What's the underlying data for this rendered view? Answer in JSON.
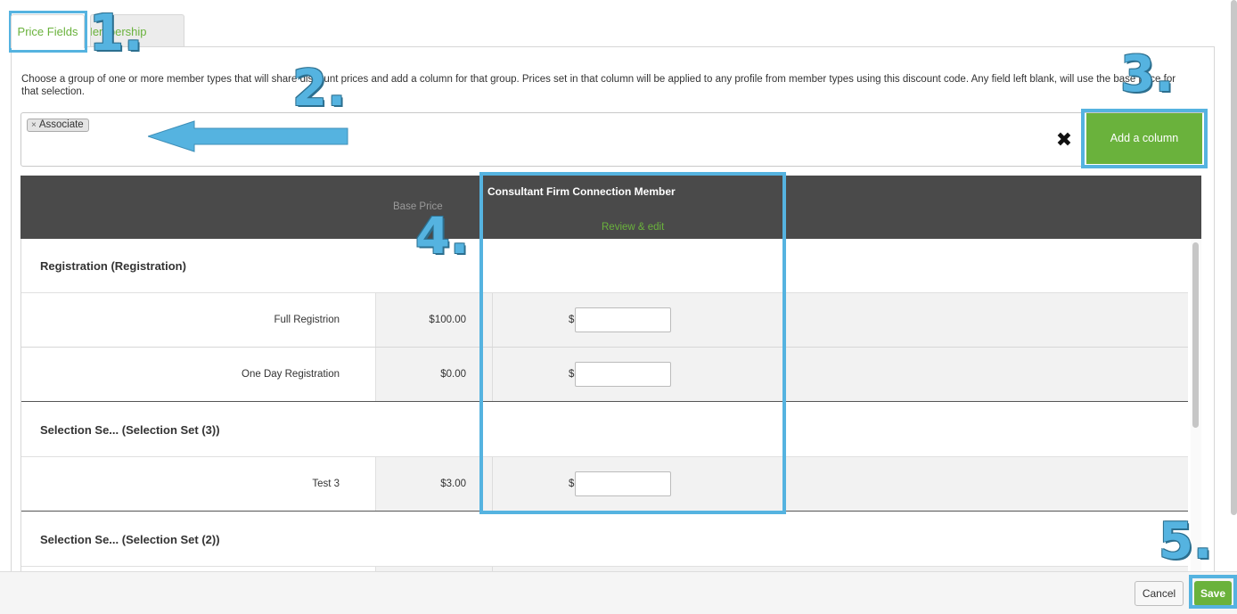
{
  "tabs": [
    {
      "label": "Price Fields",
      "active": true
    },
    {
      "label": "Membership",
      "active": false
    }
  ],
  "description": "Choose a group of one or more member types that will share discount prices and add a column for that group. Prices set in that column will be applied to any profile from member types using this discount code. Any field left blank, will use the base price for that selection.",
  "member_select": {
    "tags": [
      "Associate"
    ],
    "tag_remove_symbol": "×",
    "clear_symbol": "✖"
  },
  "add_column_label": "Add a column",
  "table": {
    "base_price_header": "Base Price",
    "column_title": "Consultant Firm Connection Member",
    "review_link": "Review & edit",
    "currency_symbol": "$",
    "groups": [
      {
        "title": "Registration (Registration)",
        "rows": [
          {
            "label": "Full Registrion",
            "base_price": "$100.00",
            "value": ""
          },
          {
            "label": "One Day Registration",
            "base_price": "$0.00",
            "value": ""
          }
        ]
      },
      {
        "title": "Selection Se... (Selection Set (3))",
        "rows": [
          {
            "label": "Test 3",
            "base_price": "$3.00",
            "value": ""
          }
        ]
      },
      {
        "title": "Selection Se... (Selection Set (2))",
        "rows": []
      }
    ]
  },
  "footer": {
    "cancel_label": "Cancel",
    "save_label": "Save"
  },
  "annotations": {
    "color": "#55b3e0",
    "steps": [
      "1.",
      "2.",
      "3.",
      "4.",
      "5."
    ]
  },
  "colors": {
    "accent_green": "#6ab23c",
    "header_dark": "#4a4a4a"
  }
}
